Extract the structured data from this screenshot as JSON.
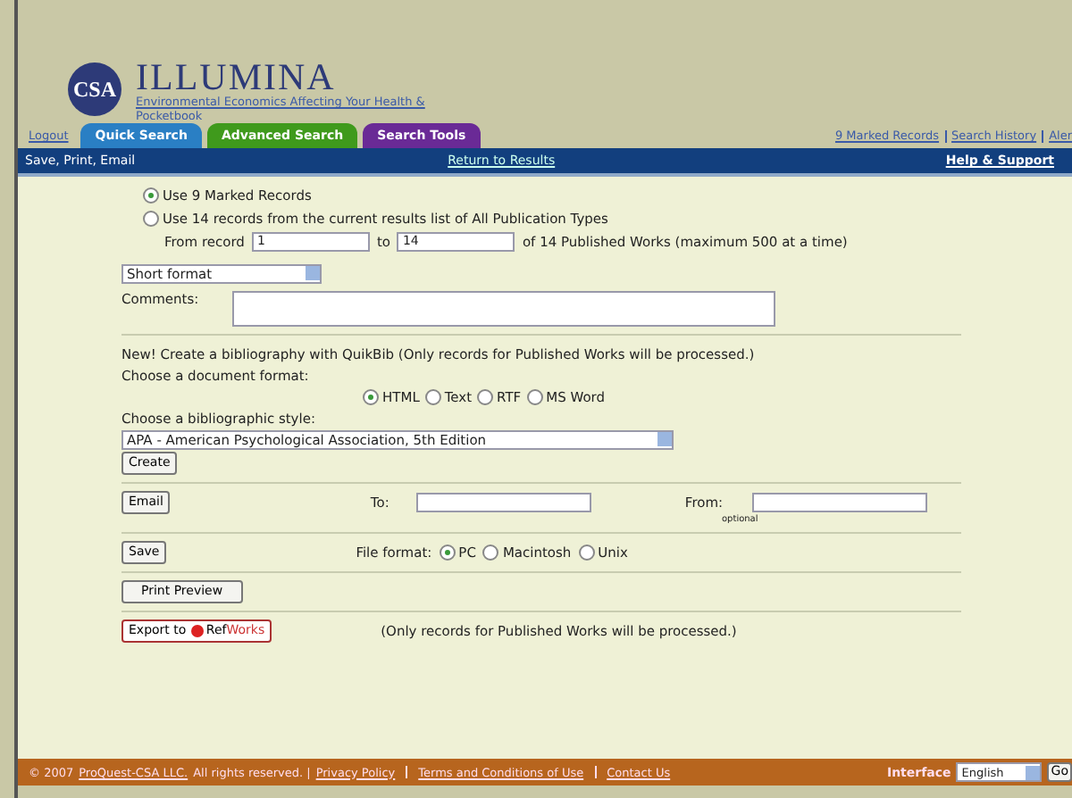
{
  "header": {
    "logo": "CSA",
    "title": "ILLUMINA",
    "subtitle": "Environmental Economics Affecting Your Health & Pocketbook",
    "logout": "Logout",
    "tabs": [
      {
        "label": "Quick Search",
        "color": "#2a7fc4"
      },
      {
        "label": "Advanced Search",
        "color": "#3f9a1c"
      },
      {
        "label": "Search Tools",
        "color": "#6a2a96"
      }
    ],
    "top_links": [
      "9 Marked Records",
      "Search History",
      "Aler"
    ]
  },
  "bar": {
    "title": "Save, Print, Email",
    "return": "Return to Results",
    "help": "Help & Support"
  },
  "records": {
    "options": [
      {
        "label": "Use 9 Marked Records",
        "selected": true
      },
      {
        "label": "Use 14 records from the current results list of All Publication Types",
        "selected": false
      }
    ],
    "from_label": "From record",
    "from_value": "1",
    "to_label": "to",
    "to_value": "14",
    "range_note": "of 14 Published Works (maximum 500 at a time)"
  },
  "format_select": "Short format",
  "comments_label": "Comments:",
  "quikbib": {
    "intro": "New! Create a bibliography with QuikBib (Only records for Published Works will be processed.)",
    "doc_format_label": "Choose a document format:",
    "doc_formats": [
      {
        "label": "HTML",
        "selected": true
      },
      {
        "label": "Text",
        "selected": false
      },
      {
        "label": "RTF",
        "selected": false
      },
      {
        "label": "MS Word",
        "selected": false
      }
    ],
    "style_label": "Choose a bibliographic style:",
    "style_value": "APA - American Psychological Association, 5th Edition",
    "create": "Create"
  },
  "email": {
    "button": "Email",
    "to_label": "To:",
    "from_label": "From:",
    "optional": "optional"
  },
  "save": {
    "button": "Save",
    "file_format_label": "File format:",
    "formats": [
      {
        "label": "PC",
        "selected": true
      },
      {
        "label": "Macintosh",
        "selected": false
      },
      {
        "label": "Unix",
        "selected": false
      }
    ]
  },
  "print": "Print Preview",
  "export": {
    "prefix": "Export to",
    "ref": "Ref",
    "works": "Works",
    "note": "(Only records for Published Works will be processed.)"
  },
  "footer": {
    "copyright": "© 2007",
    "company": "ProQuest-CSA LLC.",
    "rights": "All rights reserved. |",
    "links": [
      "Privacy Policy",
      "Terms and Conditions of Use",
      "Contact Us"
    ],
    "interface_label": "Interface",
    "language": "English",
    "go": "Go"
  }
}
